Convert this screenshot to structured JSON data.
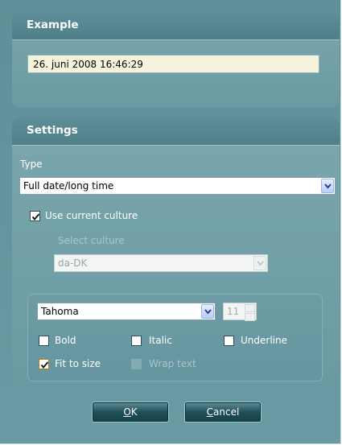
{
  "example": {
    "title": "Example",
    "value": "26. juni 2008 16:46:29"
  },
  "settings": {
    "title": "Settings",
    "type_label": "Type",
    "type_value": "Full date/long time",
    "use_current_culture": {
      "label": "Use current culture",
      "checked": true
    },
    "select_culture_label": "Select culture",
    "culture_value": "da-DK",
    "font": {
      "family": "Tahoma",
      "size": "11",
      "bold": {
        "label": "Bold",
        "checked": false
      },
      "italic": {
        "label": "Italic",
        "checked": false
      },
      "underline": {
        "label": "Underline",
        "checked": false
      },
      "fit_to_size": {
        "label": "Fit to size",
        "checked": true
      },
      "wrap_text": {
        "label": "Wrap text",
        "checked": false,
        "enabled": false
      }
    }
  },
  "buttons": {
    "ok_mnemonic": "O",
    "ok_rest": "K",
    "cancel_mnemonic": "C",
    "cancel_rest": "ancel"
  },
  "colors": {
    "background": "#6a9aa3",
    "panel_header": "#55868f",
    "example_field": "#f6f3dc",
    "button": "#1f4f5a"
  }
}
